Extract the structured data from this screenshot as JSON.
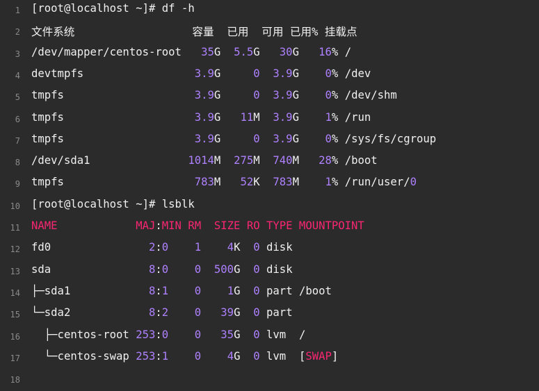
{
  "colors": {
    "background": "#2b2b2b",
    "text": "#f0f0f0",
    "number": "#ae81ff",
    "header": "#f92672",
    "gutter": "#8a8a8a"
  },
  "lines": [
    {
      "num": "1",
      "segments": [
        {
          "t": "[root@localhost ~]# df -h",
          "c": ""
        }
      ]
    },
    {
      "num": "2",
      "segments": [
        {
          "t": "文件系统                  容量  已用  可用 已用% 挂载点",
          "c": ""
        }
      ]
    },
    {
      "num": "3",
      "segments": [
        {
          "t": "/dev/mapper/centos-root   ",
          "c": ""
        },
        {
          "t": "35",
          "c": "n"
        },
        {
          "t": "G  ",
          "c": ""
        },
        {
          "t": "5.5",
          "c": "n"
        },
        {
          "t": "G   ",
          "c": ""
        },
        {
          "t": "30",
          "c": "n"
        },
        {
          "t": "G   ",
          "c": ""
        },
        {
          "t": "16",
          "c": "n"
        },
        {
          "t": "% /",
          "c": ""
        }
      ]
    },
    {
      "num": "4",
      "segments": [
        {
          "t": "devtmpfs                 ",
          "c": ""
        },
        {
          "t": "3.9",
          "c": "n"
        },
        {
          "t": "G     ",
          "c": ""
        },
        {
          "t": "0",
          "c": "n"
        },
        {
          "t": "  ",
          "c": ""
        },
        {
          "t": "3.9",
          "c": "n"
        },
        {
          "t": "G    ",
          "c": ""
        },
        {
          "t": "0",
          "c": "n"
        },
        {
          "t": "% /dev",
          "c": ""
        }
      ]
    },
    {
      "num": "5",
      "segments": [
        {
          "t": "tmpfs                    ",
          "c": ""
        },
        {
          "t": "3.9",
          "c": "n"
        },
        {
          "t": "G     ",
          "c": ""
        },
        {
          "t": "0",
          "c": "n"
        },
        {
          "t": "  ",
          "c": ""
        },
        {
          "t": "3.9",
          "c": "n"
        },
        {
          "t": "G    ",
          "c": ""
        },
        {
          "t": "0",
          "c": "n"
        },
        {
          "t": "% /dev/shm",
          "c": ""
        }
      ]
    },
    {
      "num": "6",
      "segments": [
        {
          "t": "tmpfs                    ",
          "c": ""
        },
        {
          "t": "3.9",
          "c": "n"
        },
        {
          "t": "G   ",
          "c": ""
        },
        {
          "t": "11",
          "c": "n"
        },
        {
          "t": "M  ",
          "c": ""
        },
        {
          "t": "3.9",
          "c": "n"
        },
        {
          "t": "G    ",
          "c": ""
        },
        {
          "t": "1",
          "c": "n"
        },
        {
          "t": "% /run",
          "c": ""
        }
      ]
    },
    {
      "num": "7",
      "segments": [
        {
          "t": "tmpfs                    ",
          "c": ""
        },
        {
          "t": "3.9",
          "c": "n"
        },
        {
          "t": "G     ",
          "c": ""
        },
        {
          "t": "0",
          "c": "n"
        },
        {
          "t": "  ",
          "c": ""
        },
        {
          "t": "3.9",
          "c": "n"
        },
        {
          "t": "G    ",
          "c": ""
        },
        {
          "t": "0",
          "c": "n"
        },
        {
          "t": "% /sys/fs/cgroup",
          "c": ""
        }
      ]
    },
    {
      "num": "8",
      "segments": [
        {
          "t": "/dev/sda1               ",
          "c": ""
        },
        {
          "t": "1014",
          "c": "n"
        },
        {
          "t": "M  ",
          "c": ""
        },
        {
          "t": "275",
          "c": "n"
        },
        {
          "t": "M  ",
          "c": ""
        },
        {
          "t": "740",
          "c": "n"
        },
        {
          "t": "M   ",
          "c": ""
        },
        {
          "t": "28",
          "c": "n"
        },
        {
          "t": "% /boot",
          "c": ""
        }
      ]
    },
    {
      "num": "9",
      "segments": [
        {
          "t": "tmpfs                    ",
          "c": ""
        },
        {
          "t": "783",
          "c": "n"
        },
        {
          "t": "M   ",
          "c": ""
        },
        {
          "t": "52",
          "c": "n"
        },
        {
          "t": "K  ",
          "c": ""
        },
        {
          "t": "783",
          "c": "n"
        },
        {
          "t": "M    ",
          "c": ""
        },
        {
          "t": "1",
          "c": "n"
        },
        {
          "t": "% /run/user/",
          "c": ""
        },
        {
          "t": "0",
          "c": "n"
        }
      ]
    },
    {
      "num": "10",
      "segments": [
        {
          "t": "[root@localhost ~]# lsblk",
          "c": ""
        }
      ]
    },
    {
      "num": "11",
      "segments": [
        {
          "t": "NAME            ",
          "c": "r"
        },
        {
          "t": "MAJ",
          "c": "r"
        },
        {
          "t": ":",
          "c": ""
        },
        {
          "t": "MIN RM  SIZE RO TYPE MOUNTPOINT",
          "c": "r"
        }
      ]
    },
    {
      "num": "12",
      "segments": [
        {
          "t": "fd0               ",
          "c": ""
        },
        {
          "t": "2",
          "c": "n"
        },
        {
          "t": ":",
          "c": ""
        },
        {
          "t": "0",
          "c": "n"
        },
        {
          "t": "    ",
          "c": ""
        },
        {
          "t": "1",
          "c": "n"
        },
        {
          "t": "    ",
          "c": ""
        },
        {
          "t": "4",
          "c": "n"
        },
        {
          "t": "K  ",
          "c": ""
        },
        {
          "t": "0",
          "c": "n"
        },
        {
          "t": " disk",
          "c": ""
        }
      ]
    },
    {
      "num": "13",
      "segments": [
        {
          "t": "sda               ",
          "c": ""
        },
        {
          "t": "8",
          "c": "n"
        },
        {
          "t": ":",
          "c": ""
        },
        {
          "t": "0",
          "c": "n"
        },
        {
          "t": "    ",
          "c": ""
        },
        {
          "t": "0",
          "c": "n"
        },
        {
          "t": "  ",
          "c": ""
        },
        {
          "t": "500",
          "c": "n"
        },
        {
          "t": "G  ",
          "c": ""
        },
        {
          "t": "0",
          "c": "n"
        },
        {
          "t": " disk",
          "c": ""
        }
      ]
    },
    {
      "num": "14",
      "segments": [
        {
          "t": "├─sda1            ",
          "c": ""
        },
        {
          "t": "8",
          "c": "n"
        },
        {
          "t": ":",
          "c": ""
        },
        {
          "t": "1",
          "c": "n"
        },
        {
          "t": "    ",
          "c": ""
        },
        {
          "t": "0",
          "c": "n"
        },
        {
          "t": "    ",
          "c": ""
        },
        {
          "t": "1",
          "c": "n"
        },
        {
          "t": "G  ",
          "c": ""
        },
        {
          "t": "0",
          "c": "n"
        },
        {
          "t": " part /boot",
          "c": ""
        }
      ]
    },
    {
      "num": "15",
      "segments": [
        {
          "t": "└─sda2            ",
          "c": ""
        },
        {
          "t": "8",
          "c": "n"
        },
        {
          "t": ":",
          "c": ""
        },
        {
          "t": "2",
          "c": "n"
        },
        {
          "t": "    ",
          "c": ""
        },
        {
          "t": "0",
          "c": "n"
        },
        {
          "t": "   ",
          "c": ""
        },
        {
          "t": "39",
          "c": "n"
        },
        {
          "t": "G  ",
          "c": ""
        },
        {
          "t": "0",
          "c": "n"
        },
        {
          "t": " part",
          "c": ""
        }
      ]
    },
    {
      "num": "16",
      "segments": [
        {
          "t": "  ├─centos-root ",
          "c": ""
        },
        {
          "t": "253",
          "c": "n"
        },
        {
          "t": ":",
          "c": ""
        },
        {
          "t": "0",
          "c": "n"
        },
        {
          "t": "    ",
          "c": ""
        },
        {
          "t": "0",
          "c": "n"
        },
        {
          "t": "   ",
          "c": ""
        },
        {
          "t": "35",
          "c": "n"
        },
        {
          "t": "G  ",
          "c": ""
        },
        {
          "t": "0",
          "c": "n"
        },
        {
          "t": " lvm  /",
          "c": ""
        }
      ]
    },
    {
      "num": "17",
      "segments": [
        {
          "t": "  └─centos-swap ",
          "c": ""
        },
        {
          "t": "253",
          "c": "n"
        },
        {
          "t": ":",
          "c": ""
        },
        {
          "t": "1",
          "c": "n"
        },
        {
          "t": "    ",
          "c": ""
        },
        {
          "t": "0",
          "c": "n"
        },
        {
          "t": "    ",
          "c": ""
        },
        {
          "t": "4",
          "c": "n"
        },
        {
          "t": "G  ",
          "c": ""
        },
        {
          "t": "0",
          "c": "n"
        },
        {
          "t": " lvm  [",
          "c": ""
        },
        {
          "t": "SWAP",
          "c": "r"
        },
        {
          "t": "]",
          "c": ""
        }
      ]
    },
    {
      "num": "18",
      "segments": []
    }
  ]
}
